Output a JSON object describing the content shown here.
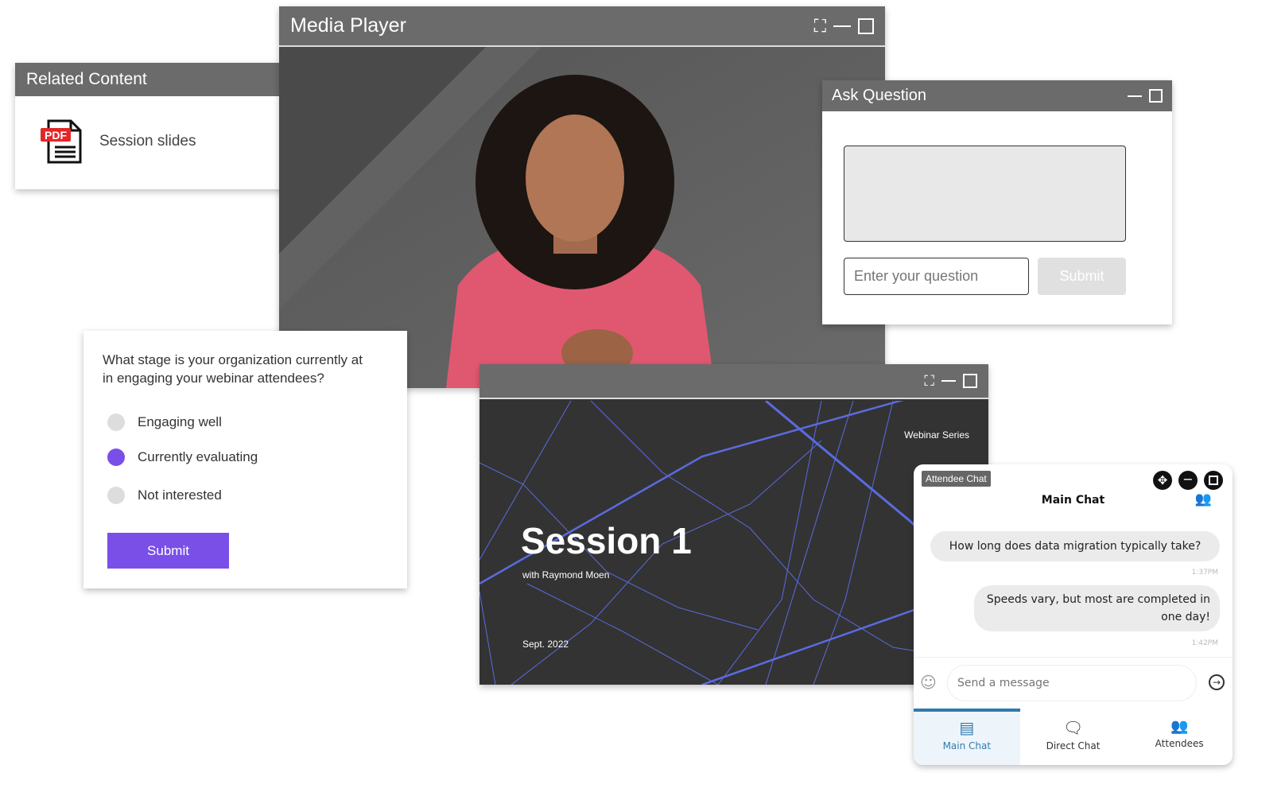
{
  "related": {
    "title": "Related Content",
    "item": "Session slides",
    "icon": "pdf-icon",
    "pdf_badge": "PDF"
  },
  "player": {
    "title": "Media Player"
  },
  "ask": {
    "title": "Ask Question",
    "placeholder": "Enter your question",
    "submit": "Submit"
  },
  "poll": {
    "question": "What stage is your organization currently at in engaging your webinar attendees?",
    "options": [
      {
        "label": "Engaging well",
        "selected": false
      },
      {
        "label": "Currently evaluating",
        "selected": true
      },
      {
        "label": "Not interested",
        "selected": false
      }
    ],
    "submit": "Submit",
    "accent": "#7a4fe8"
  },
  "slide": {
    "series": "Webinar Series",
    "title": "Session 1",
    "subtitle": "with Raymond Moen",
    "date": "Sept. 2022",
    "line_color": "#5a6be0"
  },
  "chat": {
    "badge": "Attendee Chat",
    "title": "Main Chat",
    "messages": [
      {
        "text": "How long does data migration typically take?",
        "time": "1:37PM"
      },
      {
        "text": "Speeds vary, but most are completed in one day!",
        "time": "1:42PM"
      }
    ],
    "placeholder": "Send a message",
    "tabs": [
      {
        "label": "Main Chat",
        "icon": "calendar-icon",
        "active": true
      },
      {
        "label": "Direct Chat",
        "icon": "chat-bubble-icon",
        "active": false
      },
      {
        "label": "Attendees",
        "icon": "people-icon",
        "active": false
      }
    ],
    "accent": "#2f7bb0"
  }
}
